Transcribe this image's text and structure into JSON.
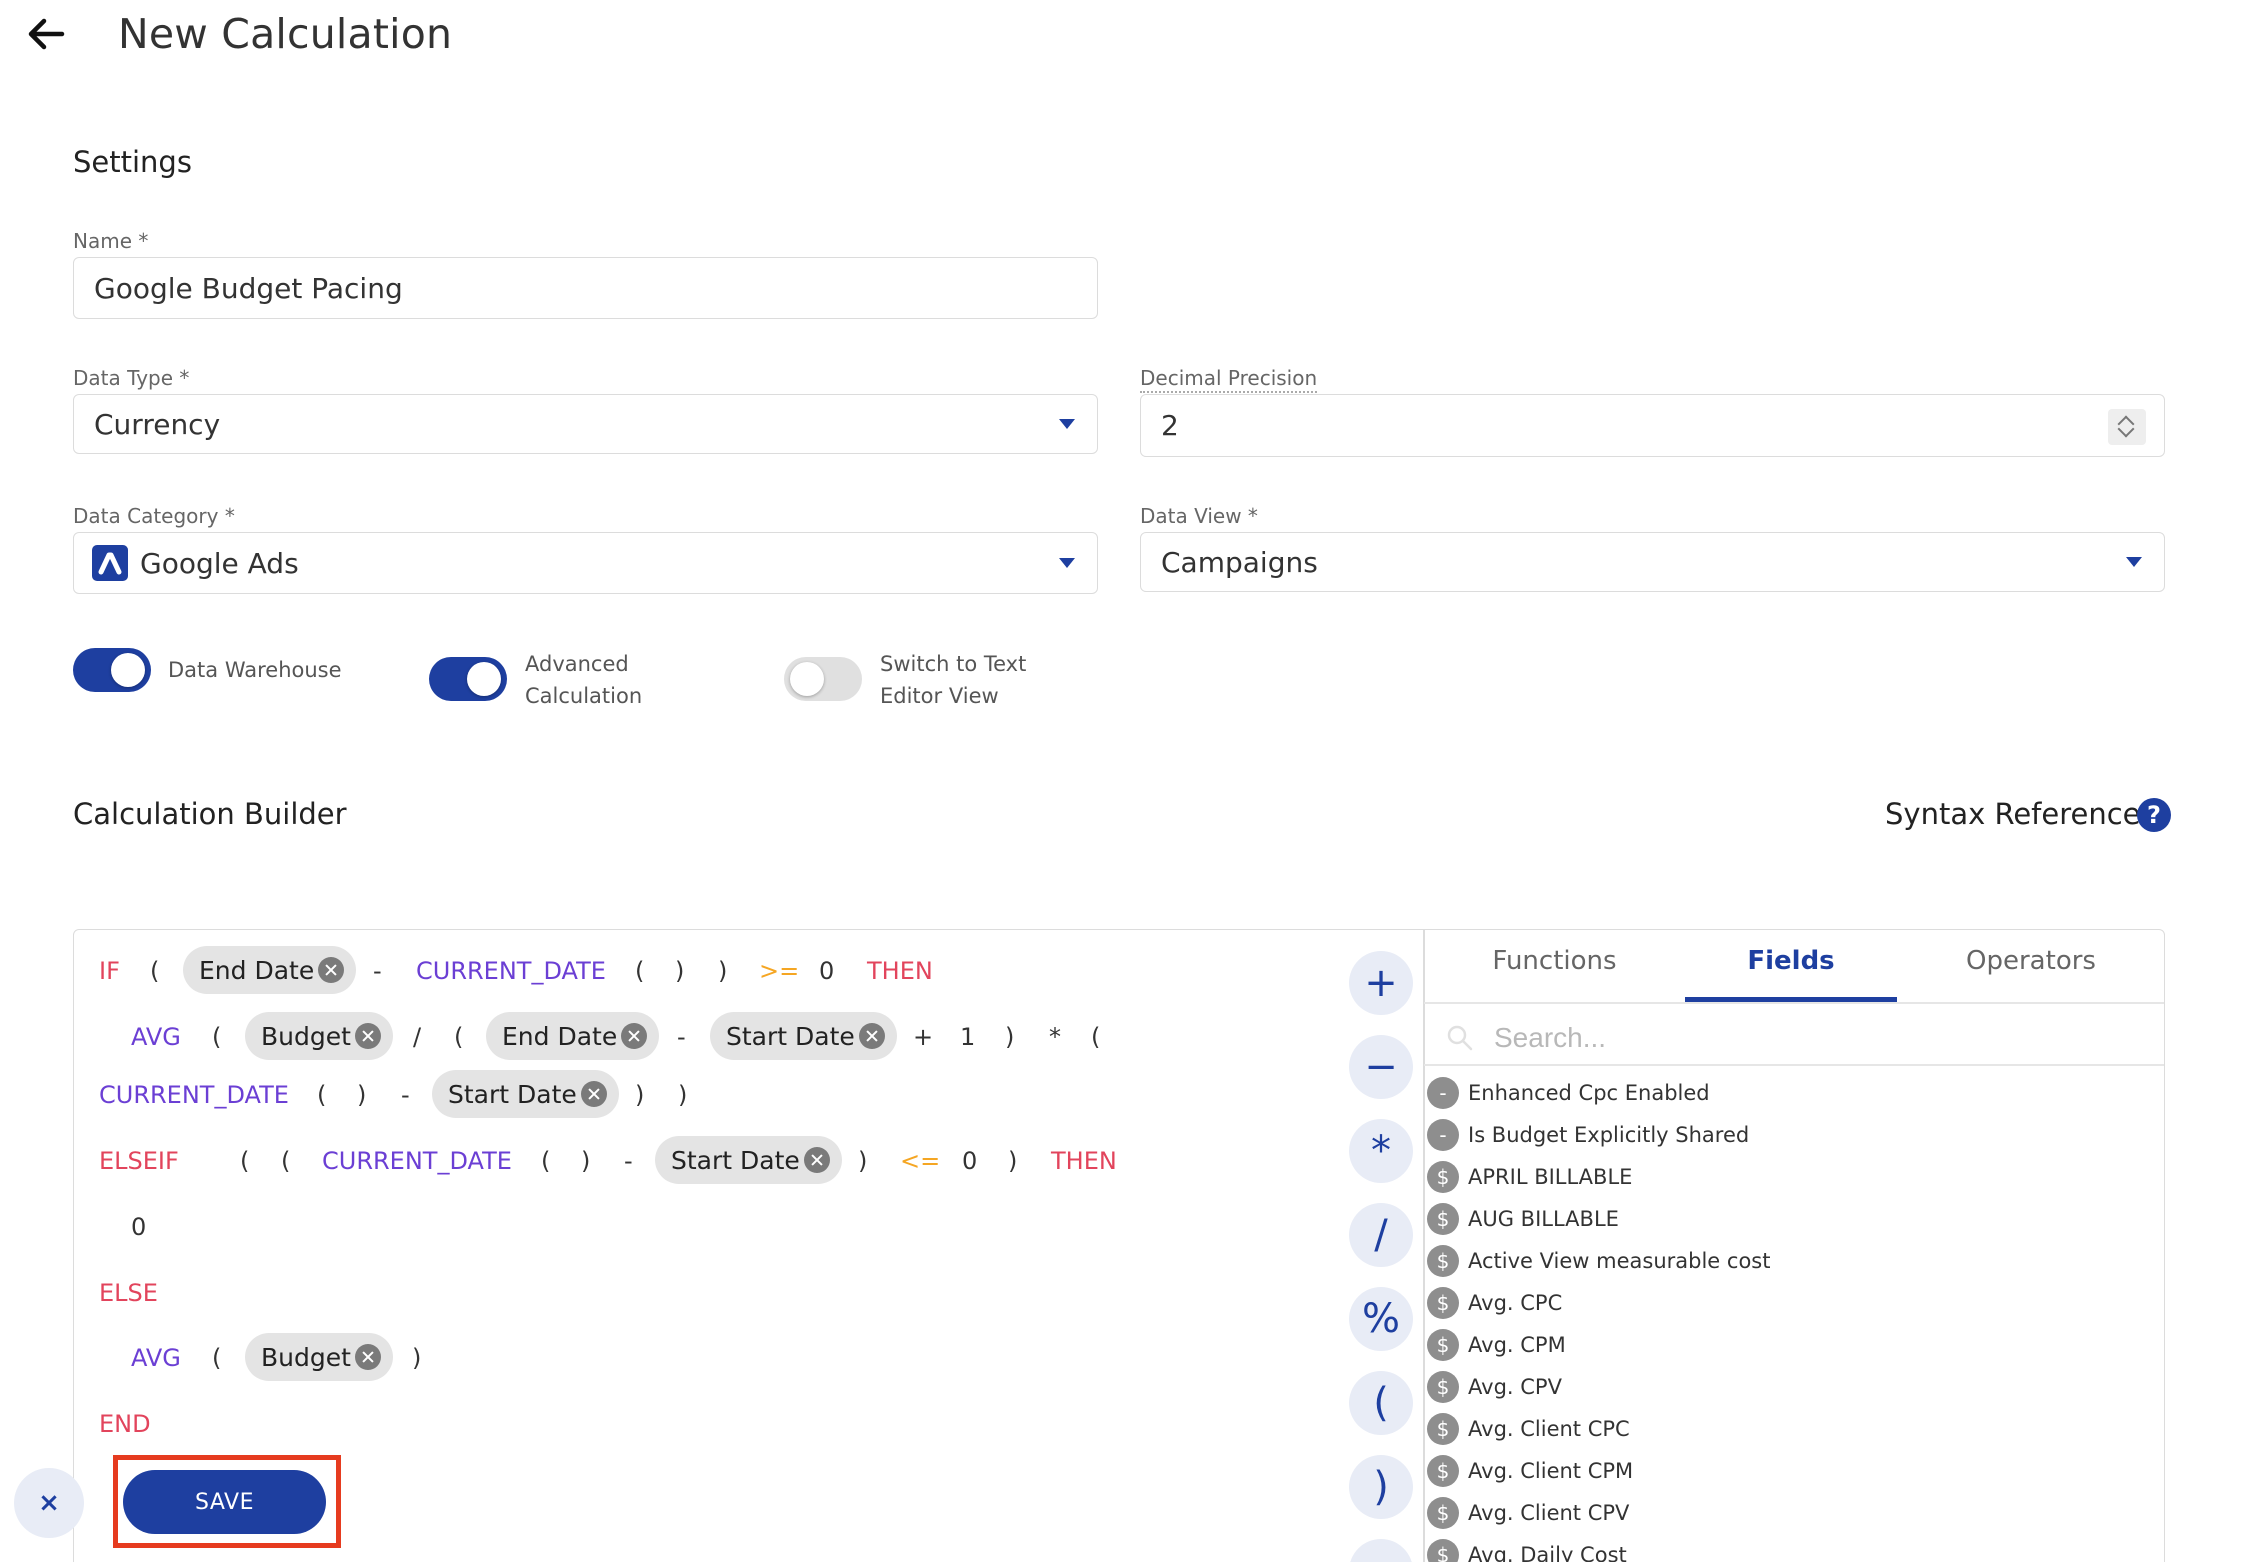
{
  "header": {
    "title": "New Calculation",
    "back_icon": "arrow-left-icon"
  },
  "settings": {
    "title": "Settings",
    "name": {
      "label": "Name *",
      "value": "Google Budget Pacing"
    },
    "data_type": {
      "label": "Data Type *",
      "value": "Currency"
    },
    "decimal_precision": {
      "label": "Decimal Precision",
      "value": "2"
    },
    "data_category": {
      "label": "Data Category *",
      "value": "Google Ads",
      "icon": "google-ads-icon"
    },
    "data_view": {
      "label": "Data View *",
      "value": "Campaigns"
    },
    "toggles": {
      "data_warehouse": {
        "label": "Data Warehouse",
        "on": true
      },
      "advanced_calculation": {
        "label_line1": "Advanced",
        "label_line2": "Calculation",
        "on": true
      },
      "text_editor": {
        "label_line1": "Switch to Text",
        "label_line2": "Editor View",
        "on": false
      }
    }
  },
  "builder": {
    "title": "Calculation Builder",
    "syntax_reference": "Syntax Reference",
    "help_glyph": "?",
    "tokens": {
      "if": "IF",
      "open_paren": "(",
      "close_paren": ")",
      "minus": "-",
      "current_date": "CURRENT_DATE",
      "gte": ">=",
      "lte": "<=",
      "zero": "0",
      "one": "1",
      "then": "THEN",
      "avg": "AVG",
      "divide": "/",
      "plus": "+",
      "multiply": "*",
      "elseif": "ELSEIF",
      "else": "ELSE",
      "end": "END"
    },
    "chips": {
      "end_date": "End Date",
      "budget": "Budget",
      "start_date": "Start Date"
    },
    "operator_buttons": [
      "+",
      "−",
      "*",
      "/",
      "%",
      "(",
      ")"
    ]
  },
  "panel": {
    "tabs": [
      "Functions",
      "Fields",
      "Operators"
    ],
    "active_tab": "Fields",
    "search_placeholder": "Search...",
    "fields": [
      {
        "icon": "-",
        "label": "Enhanced Cpc Enabled"
      },
      {
        "icon": "-",
        "label": "Is Budget Explicitly Shared"
      },
      {
        "icon": "$",
        "label": "APRIL BILLABLE"
      },
      {
        "icon": "$",
        "label": "AUG BILLABLE"
      },
      {
        "icon": "$",
        "label": "Active View measurable cost"
      },
      {
        "icon": "$",
        "label": "Avg. CPC"
      },
      {
        "icon": "$",
        "label": "Avg. CPM"
      },
      {
        "icon": "$",
        "label": "Avg. CPV"
      },
      {
        "icon": "$",
        "label": "Avg. Client CPC"
      },
      {
        "icon": "$",
        "label": "Avg. Client CPM"
      },
      {
        "icon": "$",
        "label": "Avg. Client CPV"
      },
      {
        "icon": "$",
        "label": "Avg. Daily Cost"
      }
    ]
  },
  "footer": {
    "cancel_glyph": "×",
    "save_label": "SAVE"
  },
  "colors": {
    "primary": "#1e3fa0",
    "keyword_red": "#e2445c",
    "function_purple": "#6b3fd4",
    "comparator_orange": "#f5a623",
    "highlight": "#e63b1f"
  }
}
